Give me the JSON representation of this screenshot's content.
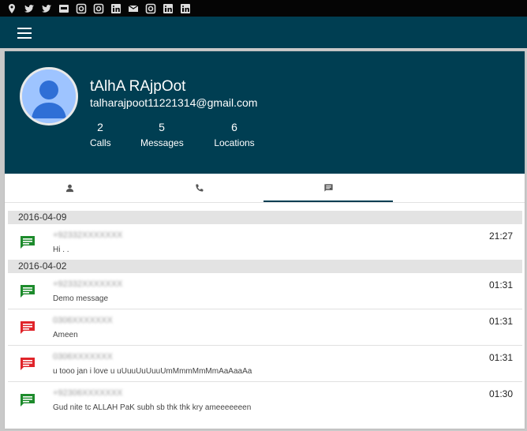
{
  "social_icons": [
    "pin-icon",
    "twitter-icon",
    "twitter-icon",
    "tumblr-icon",
    "instagram-icon",
    "instagram-icon",
    "linkedin-icon",
    "mail-icon",
    "instagram-icon",
    "linkedin-icon",
    "linkedin-icon"
  ],
  "profile": {
    "name": "tAlhA RAjpOot",
    "email": "talharajpoot11221314@gmail.com",
    "stats": [
      {
        "value": "2",
        "label": "Calls"
      },
      {
        "value": "5",
        "label": "Messages"
      },
      {
        "value": "6",
        "label": "Locations"
      }
    ]
  },
  "tabs": [
    {
      "icon": "person-icon",
      "active": false
    },
    {
      "icon": "phone-icon",
      "active": false
    },
    {
      "icon": "message-icon",
      "active": true
    }
  ],
  "groups": [
    {
      "date": "2016-04-09",
      "messages": [
        {
          "phone": "+92332XXXXXXX",
          "body": "Hi . .",
          "time": "21:27",
          "kind": "received"
        }
      ]
    },
    {
      "date": "2016-04-02",
      "messages": [
        {
          "phone": "+92332XXXXXXX",
          "body": "Demo message",
          "time": "01:31",
          "kind": "received"
        },
        {
          "phone": "0306XXXXXXX",
          "body": "Ameen",
          "time": "01:31",
          "kind": "sent"
        },
        {
          "phone": "0306XXXXXXX",
          "body": "u tooo jan i love u uUuuUuUuuUmMmmMmMmAaAaaAa",
          "time": "01:31",
          "kind": "sent"
        },
        {
          "phone": "+92306XXXXXXX",
          "body": "Gud nite tc ALLAH PaK subh sb thk thk kry ameeeeeeen",
          "time": "01:30",
          "kind": "received"
        }
      ]
    }
  ],
  "colors": {
    "primary": "#003e52",
    "received": "#1d8b2c",
    "sent": "#e0242a"
  }
}
